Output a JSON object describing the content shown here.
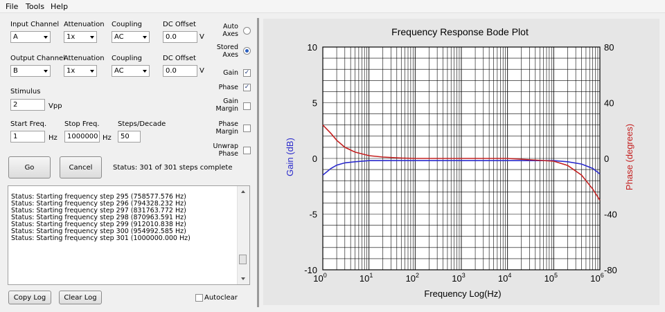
{
  "menu": {
    "file": "File",
    "tools": "Tools",
    "help": "Help"
  },
  "input": {
    "channel_label": "Input Channel",
    "channel": "A",
    "atten_label": "Attenuation",
    "atten": "1x",
    "coupling_label": "Coupling",
    "coupling": "AC",
    "dc_label": "DC Offset",
    "dc": "0.0",
    "dc_unit": "V"
  },
  "output": {
    "channel_label": "Output Channel",
    "channel": "B",
    "atten_label": "Attenuation",
    "atten": "1x",
    "coupling_label": "Coupling",
    "coupling": "AC",
    "dc_label": "DC Offset",
    "dc": "0.0",
    "dc_unit": "V"
  },
  "stimulus": {
    "label": "Stimulus",
    "value": "2",
    "unit": "Vpp"
  },
  "sweep": {
    "start_label": "Start Freq.",
    "start": "1",
    "start_unit": "Hz",
    "stop_label": "Stop Freq.",
    "stop": "1000000",
    "stop_unit": "Hz",
    "steps_label": "Steps/Decade",
    "steps": "50"
  },
  "options": {
    "auto_axes": "Auto Axes",
    "auto_axes_on": false,
    "stored_axes": "Stored Axes",
    "stored_axes_on": true,
    "gain": "Gain",
    "gain_on": true,
    "phase": "Phase",
    "phase_on": true,
    "gain_margin": "Gain Margin",
    "gain_margin_on": false,
    "phase_margin": "Phase Margin",
    "phase_margin_on": false,
    "unwrap_phase": "Unwrap Phase",
    "unwrap_phase_on": false
  },
  "buttons": {
    "go": "Go",
    "cancel": "Cancel",
    "copy_log": "Copy Log",
    "clear_log": "Clear Log"
  },
  "status": "Status: 301 of 301 steps complete",
  "log_lines": [
    "Status: Starting frequency step 295 (758577.576 Hz)",
    "Status: Starting frequency step 296 (794328.232 Hz)",
    "Status: Starting frequency step 297 (831763.772 Hz)",
    "Status: Starting frequency step 298 (870963.591 Hz)",
    "Status: Starting frequency step 299 (912010.838 Hz)",
    "Status: Starting frequency step 300 (954992.585 Hz)",
    "Status: Starting frequency step 301 (1000000.000 Hz)"
  ],
  "autoclear": {
    "label": "Autoclear",
    "checked": false
  },
  "colors": {
    "gain": "#2a2acc",
    "phase": "#c42020"
  },
  "chart_data": {
    "type": "line",
    "title": "Frequency Response Bode Plot",
    "xlabel": "Frequency Log(Hz)",
    "ylabel": "Gain (dB)",
    "y2label": "Phase (degrees)",
    "xscale": "log",
    "xlim": [
      1,
      1000000
    ],
    "ylim": [
      -10,
      10
    ],
    "y2lim": [
      -80,
      80
    ],
    "grid": true,
    "x_ticks": [
      "10^0",
      "10^1",
      "10^2",
      "10^3",
      "10^4",
      "10^5",
      "10^6"
    ],
    "y_ticks": [
      "10",
      "5",
      "0",
      "-5",
      "-10"
    ],
    "y2_ticks": [
      "80",
      "40",
      "0",
      "-40",
      "-80"
    ],
    "series": [
      {
        "name": "Gain (dB)",
        "axis": "left",
        "color": "#2a2acc",
        "x": [
          1,
          1.5,
          2,
          3,
          5,
          10,
          100,
          1000,
          10000,
          100000,
          200000,
          400000,
          700000,
          1000000
        ],
        "y": [
          -1.5,
          -0.9,
          -0.6,
          -0.4,
          -0.3,
          -0.2,
          -0.2,
          -0.2,
          -0.2,
          -0.2,
          -0.3,
          -0.5,
          -0.9,
          -1.4
        ]
      },
      {
        "name": "Phase (degrees)",
        "axis": "right",
        "color": "#c42020",
        "x": [
          1,
          1.5,
          2,
          3,
          5,
          10,
          20,
          50,
          100,
          1000,
          10000,
          100000,
          200000,
          400000,
          700000,
          1000000
        ],
        "y": [
          24,
          18,
          13,
          8,
          4.5,
          2,
          1,
          0.3,
          0,
          0,
          0,
          -2,
          -5,
          -12,
          -22,
          -30
        ]
      }
    ]
  }
}
